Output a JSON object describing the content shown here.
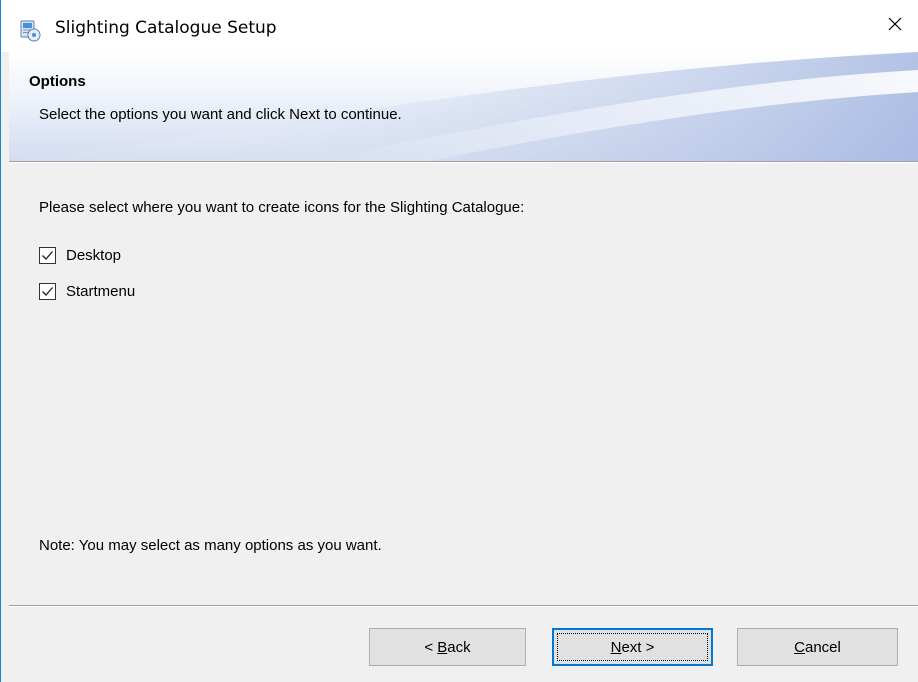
{
  "window": {
    "title": "Slighting Catalogue Setup",
    "icon": "setup-installer-icon",
    "close_icon": "close-icon",
    "accent_color": "#0078d7"
  },
  "header": {
    "title": "Options",
    "subtitle": "Select the options you want and click Next to continue."
  },
  "content": {
    "prompt": "Please select where you want to create icons for the Slighting Catalogue:",
    "options": [
      {
        "label": "Desktop",
        "checked": true
      },
      {
        "label": "Startmenu",
        "checked": true
      }
    ],
    "note": "Note: You may select as many options as you want."
  },
  "buttons": {
    "back": {
      "prefix": "< ",
      "mnemonic": "B",
      "rest": "ack"
    },
    "next": {
      "mnemonic": "N",
      "rest": "ext >"
    },
    "cancel": {
      "mnemonic": "C",
      "rest": "ancel"
    }
  }
}
